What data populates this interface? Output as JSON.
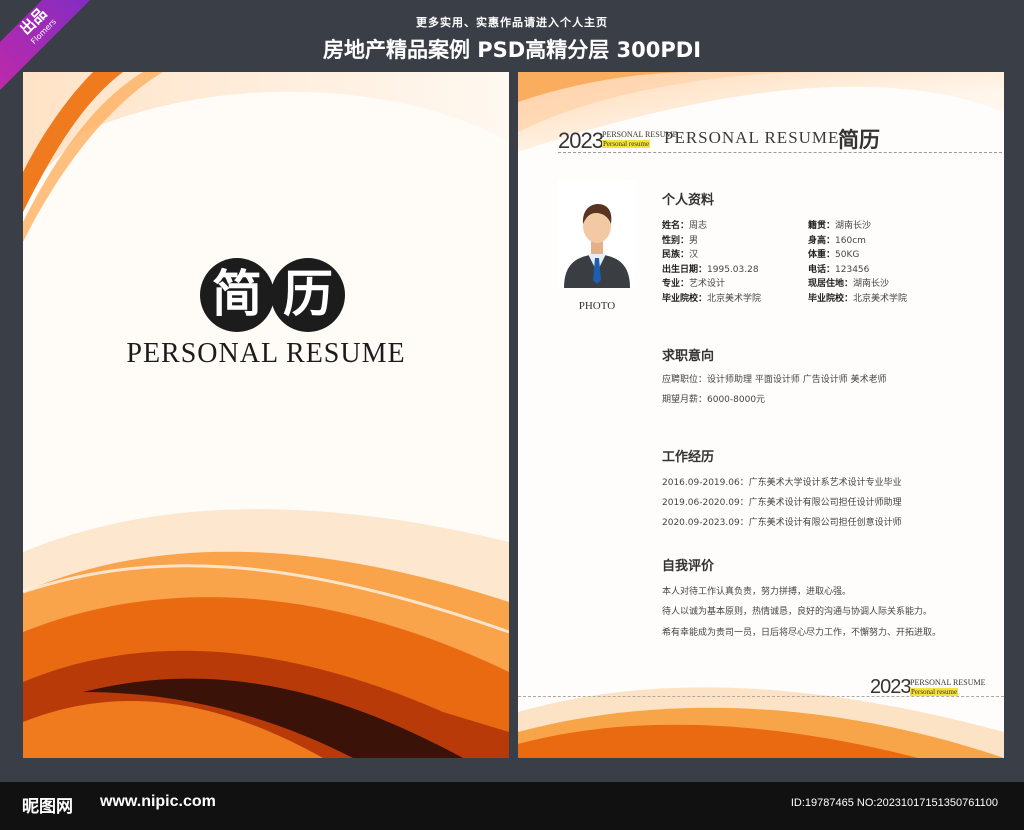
{
  "header": {
    "ribbon_top": "出品",
    "ribbon_bottom": "Flomers",
    "subtitle": "更多实用、实惠作品请进入个人主页",
    "title": "房地产精品案例 PSD高精分层 300PDI"
  },
  "cover": {
    "char1": "简",
    "char2": "历",
    "english": "PERSONAL RESUME"
  },
  "resume": {
    "year": "2023",
    "year_sub1": "PERSONAL RESUME",
    "year_sub2": "Personal resume",
    "title_en": "PERSONAL RESUME",
    "title_cn": "简历",
    "photo_label": "PHOTO",
    "profile": {
      "heading": "个人资料",
      "left": [
        {
          "label": "姓名：",
          "value": "周志"
        },
        {
          "label": "性别：",
          "value": "男"
        },
        {
          "label": "民族：",
          "value": "汉"
        },
        {
          "label": "出生日期：",
          "value": "1995.03.28"
        },
        {
          "label": "专业：",
          "value": "艺术设计"
        },
        {
          "label": "毕业院校：",
          "value": "北京美术学院"
        }
      ],
      "right": [
        {
          "label": "籍贯：",
          "value": "湖南长沙"
        },
        {
          "label": "身高：",
          "value": "160cm"
        },
        {
          "label": "体重：",
          "value": "50KG"
        },
        {
          "label": "电话：",
          "value": "123456"
        },
        {
          "label": "现居住地：",
          "value": "湖南长沙"
        },
        {
          "label": "毕业院校：",
          "value": "北京美术学院"
        }
      ]
    },
    "intent": {
      "heading": "求职意向",
      "lines": [
        "应聘职位：设计师助理  平面设计师  广告设计师  美术老师",
        "期望月薪：6000-8000元"
      ]
    },
    "work": {
      "heading": "工作经历",
      "lines": [
        "2016.09-2019.06：广东美术大学设计系艺术设计专业毕业",
        "2019.06-2020.09：广东美术设计有限公司担任设计师助理",
        "2020.09-2023.09：广东美术设计有限公司担任创意设计师"
      ]
    },
    "self": {
      "heading": "自我评价",
      "lines": [
        "本人对待工作认真负责，努力拼搏，进取心强。",
        "待人以诚为基本原则，热情诚恳，良好的沟通与协调人际关系能力。",
        "希有幸能成为贵司一员，日后将尽心尽力工作，不懈努力、开拓进取。"
      ]
    }
  },
  "footer": {
    "logo": "昵图网",
    "url": "www.nipic.com",
    "id": "ID:19787465 NO:20231017151350761100"
  }
}
